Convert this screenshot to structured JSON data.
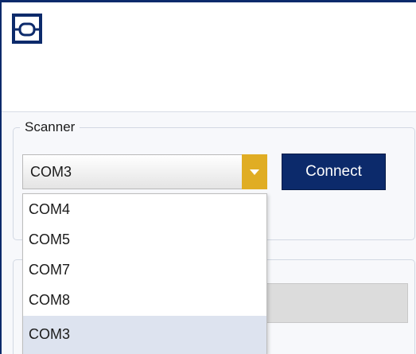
{
  "scanner_group": {
    "legend": "Scanner",
    "port_select": {
      "selected": "COM3",
      "options": [
        "COM4",
        "COM5",
        "COM7",
        "COM8",
        "COM3"
      ],
      "highlighted_index": 4
    },
    "connect_label": "Connect"
  },
  "colors": {
    "brand_navy": "#0c2a6b",
    "dropdown_accent": "#e0ad24",
    "highlight": "#dde3ef"
  },
  "icons": {
    "logo": "app-logo-icon",
    "dropdown": "chevron-down-icon"
  }
}
